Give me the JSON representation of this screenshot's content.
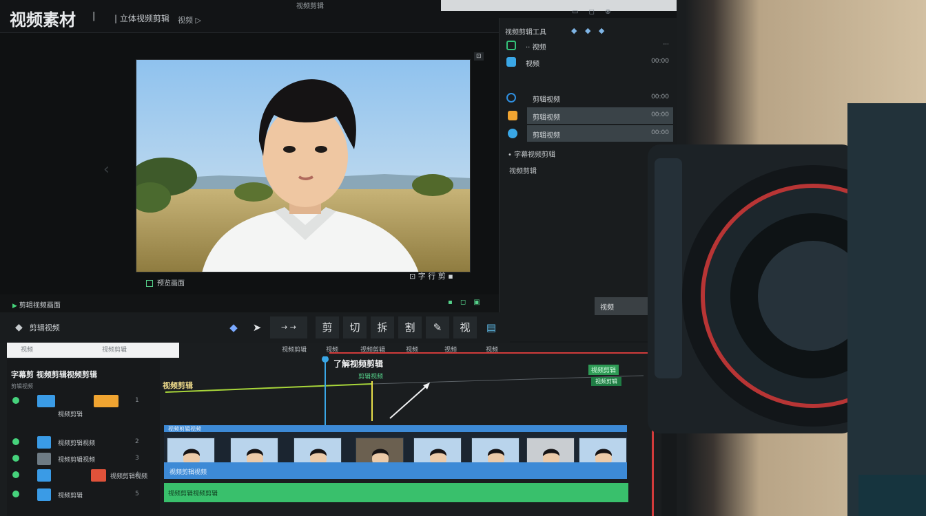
{
  "app": {
    "title": "视频素材",
    "tb_item_1": "|",
    "tb_item_2": "| 立体视频剪辑",
    "tb_item_3": "视频 ▷",
    "top_center": "视频剪辑",
    "win_btns": "▭ ◻ ⊗"
  },
  "preview": {
    "caption": "预览画面",
    "meta": "⊡ 字 行 剪 ▪",
    "corner_badge": "⊡"
  },
  "sidebar": {
    "title": "视频剪辑工具",
    "ctrls": "◆ ◆ ◆",
    "rows": [
      {
        "label": "·· 视频",
        "val": "···",
        "color": "#34c37a"
      },
      {
        "label": "视频",
        "val": "00:00",
        "color": "#3aa7e6"
      },
      {
        "label": "剪辑视频",
        "val": "00:00",
        "color": "#2f8fe0"
      },
      {
        "label": "剪辑视频",
        "val": "00:00",
        "color": "#f0a431"
      },
      {
        "label": "剪辑视频",
        "val": "00:00",
        "color": "#3aa7e6"
      }
    ],
    "foot_1": "• 字幕视频剪辑",
    "foot_2": "视频剪辑",
    "chip": "视频"
  },
  "sub_bar": {
    "label": "剪辑视频画面",
    "right": "▪ ◻ ▣"
  },
  "toolbar": {
    "left_label": "剪辑视频",
    "tools": [
      "◆",
      "➤",
      "→ →",
      "剪",
      "切",
      "拆",
      "割",
      "✎",
      "视",
      "▤"
    ]
  },
  "timeline": {
    "tabs": [
      "视频",
      "视频剪辑",
      "视频剪辑",
      "视频",
      "视频剪辑",
      "视频",
      "视频",
      "视频"
    ],
    "track_title": "字幕剪 视频剪辑视频剪辑",
    "track_sub": "剪辑视频",
    "track_rows": [
      {
        "label": "视频剪辑",
        "idx": "1",
        "color": "#3a9be6",
        "accent": "#f0a431"
      },
      {
        "label": "视频剪辑视频",
        "idx": "2",
        "color": "#3a9be6",
        "accent": ""
      },
      {
        "label": "视频剪辑视频",
        "idx": "3",
        "color": "#3a9be6",
        "accent": ""
      },
      {
        "label": "视频剪辑视频",
        "idx": "4",
        "color": "#3a9be6",
        "accent": "#e0523a"
      },
      {
        "label": "视频剪辑",
        "idx": "5",
        "color": "#3a9be6",
        "accent": ""
      }
    ],
    "top_label": "视频剪辑",
    "head_label": "了解视频剪辑",
    "head_sub": "剪辑视频",
    "badge": "视频剪辑",
    "badge_2": "视频剪辑",
    "strip_head": "视频剪辑视频",
    "blue_track": "视频剪辑视频",
    "green_track": "视频剪辑视频剪辑"
  },
  "colors": {
    "accent_green": "#39c06c",
    "accent_blue": "#3d8ad6",
    "marker_red": "#d23b3b"
  }
}
